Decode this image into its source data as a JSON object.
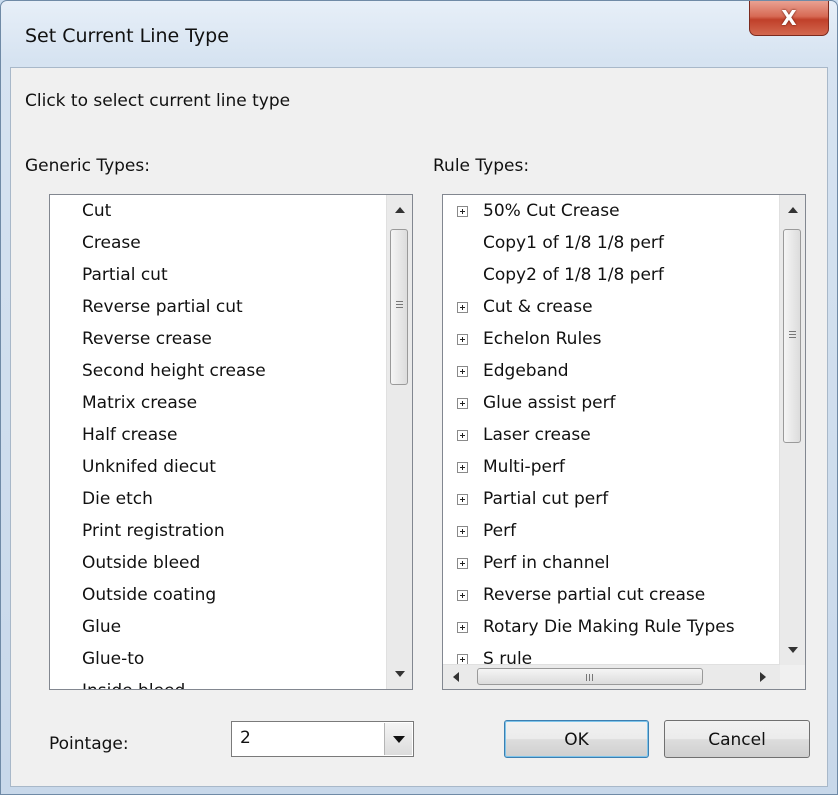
{
  "window": {
    "title": "Set Current Line Type",
    "close_glyph": "X"
  },
  "instructions": "Click to select current line type",
  "generic": {
    "label": "Generic Types:",
    "items": [
      "Cut",
      "Crease",
      "Partial cut",
      "Reverse partial cut",
      "Reverse crease",
      "Second height crease",
      "Matrix crease",
      "Half crease",
      "Unknifed diecut",
      "Die etch",
      "Print registration",
      "Outside bleed",
      "Outside coating",
      "Glue",
      "Glue-to",
      "Inside bleed"
    ]
  },
  "rule": {
    "label": "Rule Types:",
    "items": [
      {
        "label": "50% Cut Crease",
        "expandable": true
      },
      {
        "label": "Copy1 of 1/8 1/8 perf",
        "expandable": false
      },
      {
        "label": "Copy2 of 1/8 1/8 perf",
        "expandable": false
      },
      {
        "label": "Cut & crease",
        "expandable": true
      },
      {
        "label": "Echelon Rules",
        "expandable": true
      },
      {
        "label": "Edgeband",
        "expandable": true
      },
      {
        "label": "Glue assist perf",
        "expandable": true
      },
      {
        "label": "Laser crease",
        "expandable": true
      },
      {
        "label": "Multi-perf",
        "expandable": true
      },
      {
        "label": "Partial cut perf",
        "expandable": true
      },
      {
        "label": "Perf",
        "expandable": true
      },
      {
        "label": "Perf in channel",
        "expandable": true
      },
      {
        "label": "Reverse partial cut crease",
        "expandable": true
      },
      {
        "label": "Rotary Die Making Rule Types",
        "expandable": true
      },
      {
        "label": "S rule",
        "expandable": true
      }
    ]
  },
  "pointage": {
    "label": "Pointage:",
    "value": "2"
  },
  "buttons": {
    "ok": "OK",
    "cancel": "Cancel"
  },
  "icons": {
    "expand": "plus-box-icon",
    "scroll_up": "arrow-up-icon",
    "scroll_down": "arrow-down-icon",
    "scroll_left": "arrow-left-icon",
    "scroll_right": "arrow-right-icon",
    "dropdown": "chevron-down-icon"
  },
  "colors": {
    "close_button": "#c0402a",
    "list_background": "#ffffff",
    "dialog_background": "#f0f0f0"
  }
}
